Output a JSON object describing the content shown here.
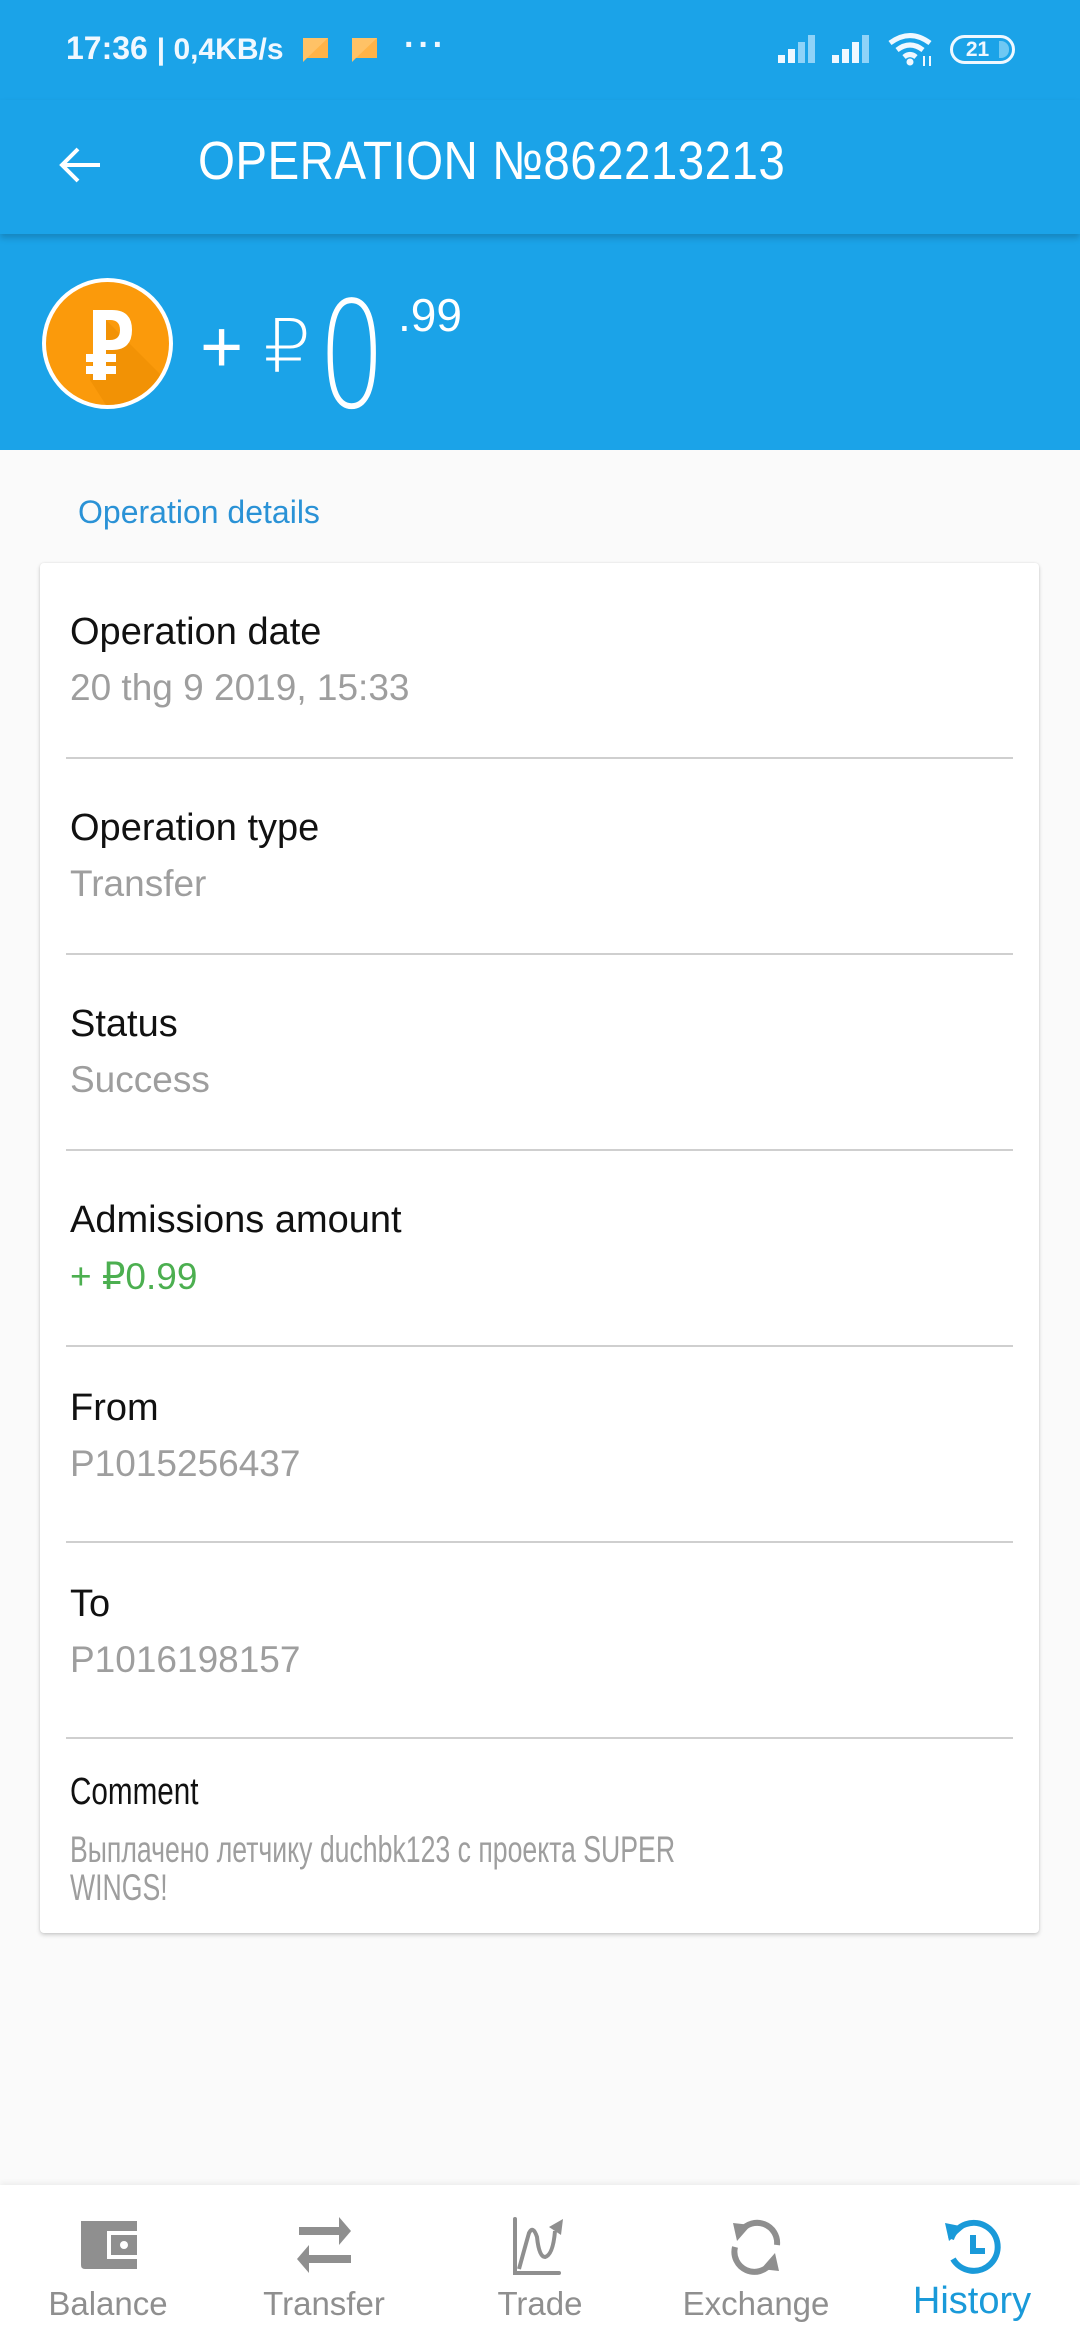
{
  "status_bar": {
    "time": "17:36",
    "network_speed": "| 0,4KB/s",
    "notifications": [
      "message-icon",
      "message-icon"
    ],
    "more": "···",
    "battery_level": "21",
    "icons": [
      "signal-icon",
      "signal-icon",
      "wifi-icon",
      "battery-icon"
    ]
  },
  "app_bar": {
    "back_icon": "arrow-left-icon",
    "title": "OPERATION №862213213"
  },
  "amount_header": {
    "currency_icon": "ruble-coin-icon",
    "sign": "+ ₽",
    "integer": "0",
    "decimal": ".99",
    "colors": {
      "background": "#1ba3e8",
      "coin": "#fb9a0b"
    }
  },
  "details": {
    "section_label": "Operation details",
    "rows": [
      {
        "label": "Operation date",
        "value": "20 thg 9 2019, 15:33"
      },
      {
        "label": "Operation type",
        "value": "Transfer"
      },
      {
        "label": "Status",
        "value": "Success"
      },
      {
        "label": "Admissions amount",
        "value": "+ ₽0.99",
        "value_color": "#4caf50"
      },
      {
        "label": "From",
        "value": "P1015256437"
      },
      {
        "label": "To",
        "value": "P1016198157"
      },
      {
        "label": "Comment",
        "value_line1": "Выплачено летчику duchbk123 с проекта SUPER",
        "value_line2": "WINGS!"
      }
    ]
  },
  "bottom_nav": {
    "items": [
      {
        "label": "Balance",
        "icon": "wallet-icon",
        "active": false
      },
      {
        "label": "Transfer",
        "icon": "transfer-arrows-icon",
        "active": false
      },
      {
        "label": "Trade",
        "icon": "trade-chart-icon",
        "active": false
      },
      {
        "label": "Exchange",
        "icon": "exchange-refresh-icon",
        "active": false
      },
      {
        "label": "History",
        "icon": "history-icon",
        "active": true
      }
    ],
    "active_color": "#1a9ad9",
    "inactive_color": "#8f8f8f"
  }
}
